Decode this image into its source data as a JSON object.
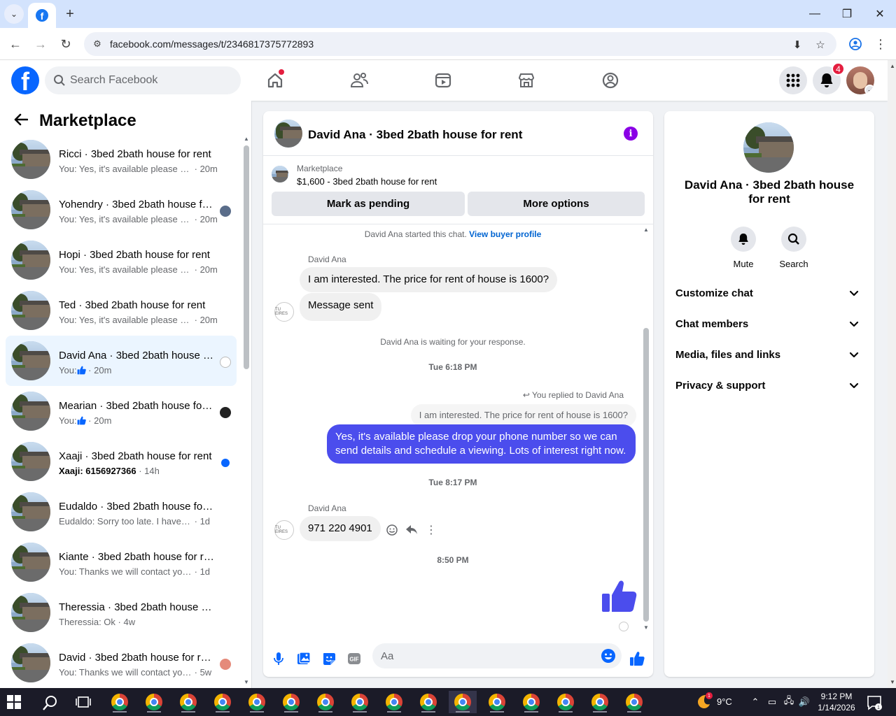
{
  "browser": {
    "url": "facebook.com/messages/t/2346817375772893"
  },
  "fbnav": {
    "search_placeholder": "Search Facebook",
    "notifications_count": "4"
  },
  "left": {
    "title": "Marketplace",
    "conversations": [
      {
        "name": "Ricci · 3bed 2bath house for rent",
        "preview": "You: Yes, it's available please drop...",
        "time": "20m",
        "bold": false
      },
      {
        "name": "Yohendry · 3bed 2bath house for rent",
        "preview": "You: Yes, it's available please dr...",
        "time": "20m",
        "bold": false
      },
      {
        "name": "Hopi · 3bed 2bath house for rent",
        "preview": "You: Yes, it's available please drop...",
        "time": "20m",
        "bold": false
      },
      {
        "name": "Ted · 3bed 2bath house for rent",
        "preview": "You: Yes, it's available please drop...",
        "time": "20m",
        "bold": false
      },
      {
        "name": "David Ana · 3bed 2bath house for rent",
        "preview": "You:",
        "time": "20m",
        "bold": false,
        "like": true,
        "active": true
      },
      {
        "name": "Mearian · 3bed 2bath house for rent",
        "preview": "You:",
        "time": "20m",
        "bold": false,
        "like": true
      },
      {
        "name": "Xaaji · 3bed 2bath house for rent",
        "preview": "Xaaji: 6156927366",
        "time": "14h",
        "bold": true
      },
      {
        "name": "Eudaldo · 3bed 2bath house for rent",
        "preview": "Eudaldo: Sorry too late. I have a ho...",
        "time": "1d",
        "bold": false
      },
      {
        "name": "Kiante · 3bed 2bath house for rent",
        "preview": "You: Thanks we will contact you so...",
        "time": "1d",
        "bold": false
      },
      {
        "name": "Theressia · 3bed 2bath house for rent",
        "preview": "Theressia: Ok",
        "time": "4w",
        "bold": false
      },
      {
        "name": "David · 3bed 2bath house for rent",
        "preview": "You: Thanks we will contact you ...",
        "time": "5w",
        "bold": false
      }
    ]
  },
  "chat": {
    "title": "David Ana · 3bed 2bath house for rent",
    "marketplace_label": "Marketplace",
    "listing": "$1,600 - 3bed 2bath house for rent",
    "mark_pending": "Mark as pending",
    "more_options": "More options",
    "started_text": "David Ana started this chat.",
    "buyer_profile_link": "View buyer profile",
    "sender1": "David Ana",
    "msg1": "I am interested.  The price for rent of house is 1600?",
    "msg2": "Message sent",
    "waiting": "David Ana is waiting for your response.",
    "ts1": "Tue 6:18 PM",
    "replied_to": "You replied to David Ana",
    "quoted": "I am interested.  The price for rent of house is 1600?",
    "msg_out": "Yes, it's available please drop your phone number so we can send details and schedule a viewing. Lots of interest right now.",
    "ts2": "Tue 8:17 PM",
    "sender2": "David Ana",
    "msg3": "971 220 4901",
    "ts3": "8:50 PM",
    "composer_placeholder": "Aa"
  },
  "info": {
    "name": "David Ana · 3bed 2bath house for rent",
    "mute": "Mute",
    "search": "Search",
    "sections": [
      "Customize chat",
      "Chat members",
      "Media, files and links",
      "Privacy & support"
    ]
  },
  "taskbar": {
    "temp": "9°C",
    "time": "9:12 PM",
    "date": "1/14/2026",
    "notif_count": "1"
  },
  "colors": {
    "fb_blue": "#0866ff",
    "out_bubble": "#4b4ded",
    "info_purple": "#8a00e6"
  }
}
